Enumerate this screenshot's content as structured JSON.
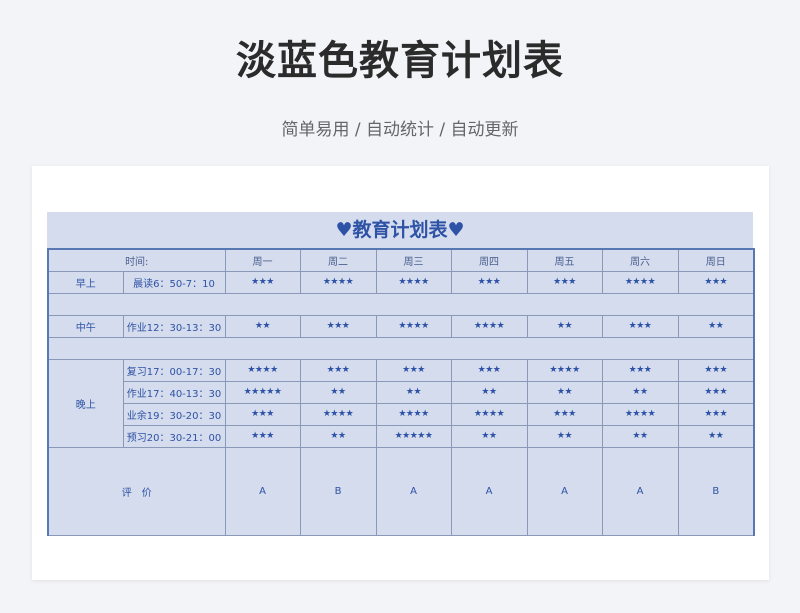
{
  "page": {
    "title": "淡蓝色教育计划表",
    "subtitle": "简单易用 / 自动统计 / 自动更新"
  },
  "sheet": {
    "title": "♥教育计划表♥",
    "time_label": "时间:",
    "days": [
      "周一",
      "周二",
      "周三",
      "周四",
      "周五",
      "周六",
      "周日"
    ],
    "morning": {
      "label": "早上",
      "time": "晨读6：50-7：10",
      "stars": [
        "★★★",
        "★★★★",
        "★★★★",
        "★★★",
        "★★★",
        "★★★★",
        "★★★"
      ]
    },
    "noon": {
      "label": "中午",
      "time": "作业12：30-13：30",
      "stars": [
        "★★",
        "★★★",
        "★★★★",
        "★★★★",
        "★★",
        "★★★",
        "★★"
      ]
    },
    "evening": {
      "label": "晚上",
      "rows": [
        {
          "time": "复习17：00-17：30",
          "stars": [
            "★★★★",
            "★★★",
            "★★★",
            "★★★",
            "★★★★",
            "★★★",
            "★★★"
          ]
        },
        {
          "time": "作业17：40-13：30",
          "stars": [
            "★★★★★",
            "★★",
            "★★",
            "★★",
            "★★",
            "★★",
            "★★★"
          ]
        },
        {
          "time": "业余19：30-20：30",
          "stars": [
            "★★★",
            "★★★★",
            "★★★★",
            "★★★★",
            "★★★",
            "★★★★",
            "★★★"
          ]
        },
        {
          "time": "预习20：30-21：00",
          "stars": [
            "★★★",
            "★★",
            "★★★★★",
            "★★",
            "★★",
            "★★",
            "★★"
          ]
        }
      ]
    },
    "evaluation": {
      "label": "评　价",
      "grades": [
        "A",
        "B",
        "A",
        "A",
        "A",
        "A",
        "B"
      ]
    }
  },
  "colors": {
    "accent": "#2e52a6",
    "cell_bg": "#d4dced",
    "border": "#8a99b8"
  }
}
